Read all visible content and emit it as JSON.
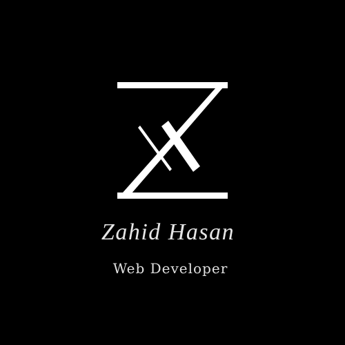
{
  "brand": {
    "logo_icon": "z-monogram-icon",
    "name": "Zahid Hasan",
    "tagline": "Web Developer"
  },
  "colors": {
    "background": "#000000",
    "foreground": "#ffffff",
    "text": "#e6e6e6"
  }
}
